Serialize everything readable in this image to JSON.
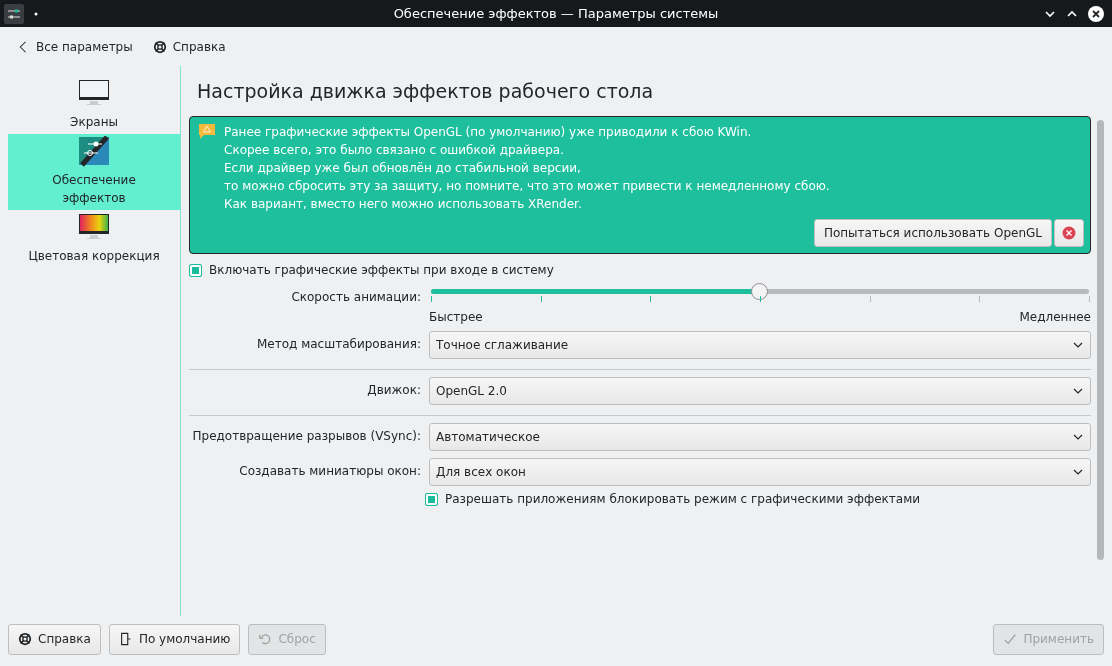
{
  "window": {
    "title": "Обеспечение эффектов — Параметры системы"
  },
  "toolbar": [
    {
      "kind": "back",
      "label": "Все параметры"
    },
    {
      "kind": "help",
      "label": "Справка"
    }
  ],
  "sidebar": {
    "items": [
      {
        "kind": "screens",
        "label": "Экраны",
        "selected": false
      },
      {
        "kind": "effects",
        "label": "Обеспечение эффектов",
        "selected": true
      },
      {
        "kind": "color",
        "label": "Цветовая коррекция",
        "selected": false
      }
    ]
  },
  "page_title": "Настройка движка эффектов рабочего стола",
  "message": {
    "lines": [
      "Ранее графические эффекты OpenGL (по умолчанию) уже приводили к сбою KWin.",
      "Скорее всего, это было связано с ошибкой драйвера.",
      "Если драйвер уже был обновлён до стабильной версии,",
      "то можно сбросить эту за защиту, но помните, что это может привести к немедленному сбою.",
      "Как вариант, вместо него можно использовать XRender."
    ],
    "action": "Попытаться использовать OpenGL"
  },
  "enable_on_startup": {
    "label": "Включать графические эффекты при входе в систему",
    "checked": true
  },
  "animation_speed": {
    "label": "Скорость анимации:",
    "level": 0.5,
    "min_label": "Быстрее",
    "max_label": "Медленнее"
  },
  "groups": [
    [
      {
        "label": "Метод масштабирования:",
        "value": "Точное сглаживание"
      }
    ],
    [
      {
        "label": "Движок:",
        "value": "OpenGL 2.0"
      }
    ],
    [
      {
        "label": "Предотвращение разрывов (VSync):",
        "value": "Автоматическое"
      },
      {
        "label": "Создавать миниатюры окон:",
        "value": "Для всех окон"
      }
    ]
  ],
  "allow_block": {
    "label": "Разрешать приложениям блокировать режим с графическими эффектами",
    "checked": true
  },
  "buttons": [
    {
      "kind": "help",
      "label": "Справка",
      "disabled": false
    },
    {
      "kind": "defaults",
      "label": "По умолчанию",
      "disabled": false
    },
    {
      "kind": "reset",
      "label": "Сброс",
      "disabled": true
    },
    {
      "kind": "apply",
      "label": "Применить",
      "disabled": true
    }
  ]
}
